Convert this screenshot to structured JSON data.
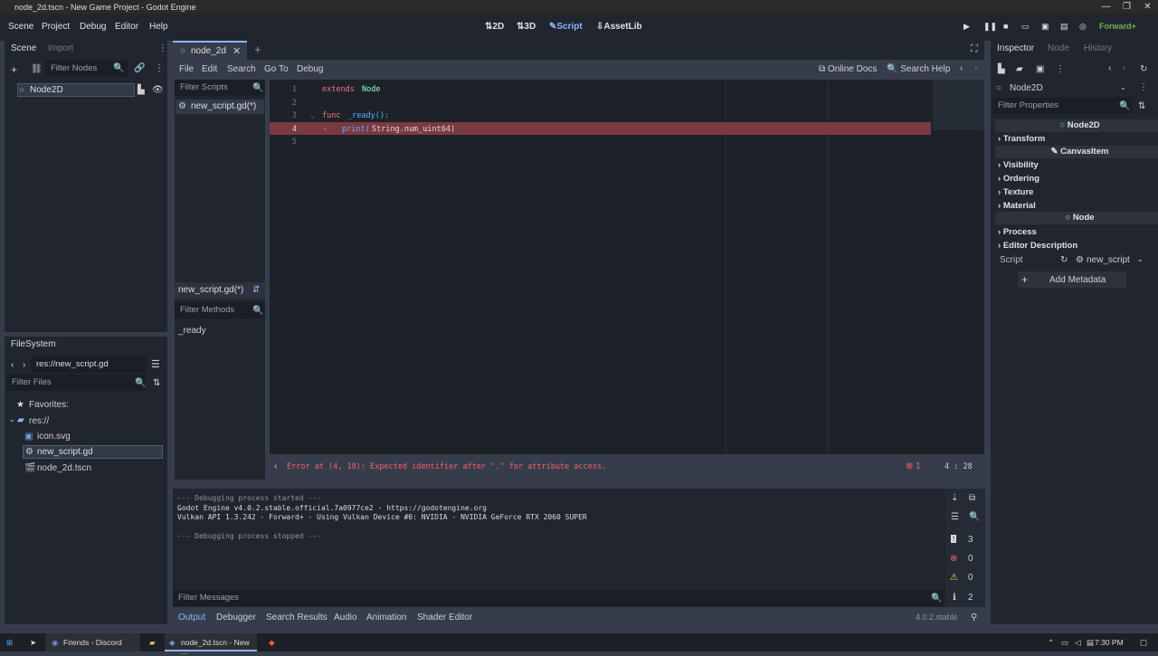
{
  "window": {
    "title": "node_2d.tscn - New Game Project - Godot Engine"
  },
  "menu": [
    "Scene",
    "Project",
    "Debug",
    "Editor",
    "Help"
  ],
  "workspaces": {
    "w2d": "2D",
    "w3d": "3D",
    "script": "Script",
    "assetlib": "AssetLib"
  },
  "renderer": "Forward+",
  "scene_dock": {
    "tabs": [
      "Scene",
      "Import"
    ],
    "filter_placeholder": "Filter Nodes",
    "root_node": "Node2D"
  },
  "filesystem": {
    "tab": "FileSystem",
    "path": "res://new_script.gd",
    "filter_placeholder": "Filter Files",
    "favorites": "Favorites:",
    "root": "res://",
    "files": [
      "icon.svg",
      "new_script.gd",
      "node_2d.tscn"
    ]
  },
  "editor": {
    "scene_tab": "node_2d",
    "menu": [
      "File",
      "Edit",
      "Search",
      "Go To",
      "Debug"
    ],
    "online_docs": "Online Docs",
    "search_help": "Search Help",
    "filter_scripts": "Filter Scripts",
    "scripts": [
      "new_script.gd(*)"
    ],
    "current_script": "new_script.gd(*)",
    "filter_methods": "Filter Methods",
    "methods": [
      "_ready"
    ],
    "lines": {
      "n1": "1",
      "n2": "2",
      "n3": "3",
      "n4": "4",
      "n5": "5",
      "l1_kw": "extends",
      "l1_ty": "Node",
      "l3_kw": "func",
      "l3_fn": "_ready():",
      "l4_fn": "print(",
      "l4_rest": "String.num_uint64)"
    },
    "error": "Error at (4, 18): Expected identifier after \".\" for attribute access.",
    "error_count": "1",
    "cursor": "4 :   28"
  },
  "output": {
    "lines": [
      "--- Debugging process started ---",
      "Godot Engine v4.0.2.stable.official.7a0977ce2 - https://godotengine.org",
      "Vulkan API 1.3.242 - Forward+ - Using Vulkan Device #0: NVIDIA - NVIDIA GeForce RTX 2060 SUPER",
      "",
      "--- Debugging process stopped ---"
    ],
    "filter_placeholder": "Filter Messages",
    "counts": {
      "messages": "3",
      "errors": "0",
      "warnings": "0",
      "info": "2"
    }
  },
  "bottom_tabs": [
    "Output",
    "Debugger",
    "Search Results",
    "Audio",
    "Animation",
    "Shader Editor"
  ],
  "version": "4.0.2.stable",
  "inspector": {
    "tabs": [
      "Inspector",
      "Node",
      "History"
    ],
    "node": "Node2D",
    "filter_placeholder": "Filter Properties",
    "class_node2d": "Node2D",
    "transform": "Transform",
    "class_canvasitem": "CanvasItem",
    "visibility": "Visibility",
    "ordering": "Ordering",
    "texture": "Texture",
    "material": "Material",
    "class_node": "Node",
    "process": "Process",
    "editor_description": "Editor Description",
    "script_label": "Script",
    "script_value": "new_script",
    "add_metadata": "Add Metadata"
  },
  "taskbar": {
    "discord": "Friends - Discord",
    "godot": "node_2d.tscn - New ...",
    "time": "7:30 PM"
  },
  "colors": {
    "accent": "#8eb5ff",
    "error_line": "#7a3a40",
    "error_text": "#ff5d6a"
  }
}
